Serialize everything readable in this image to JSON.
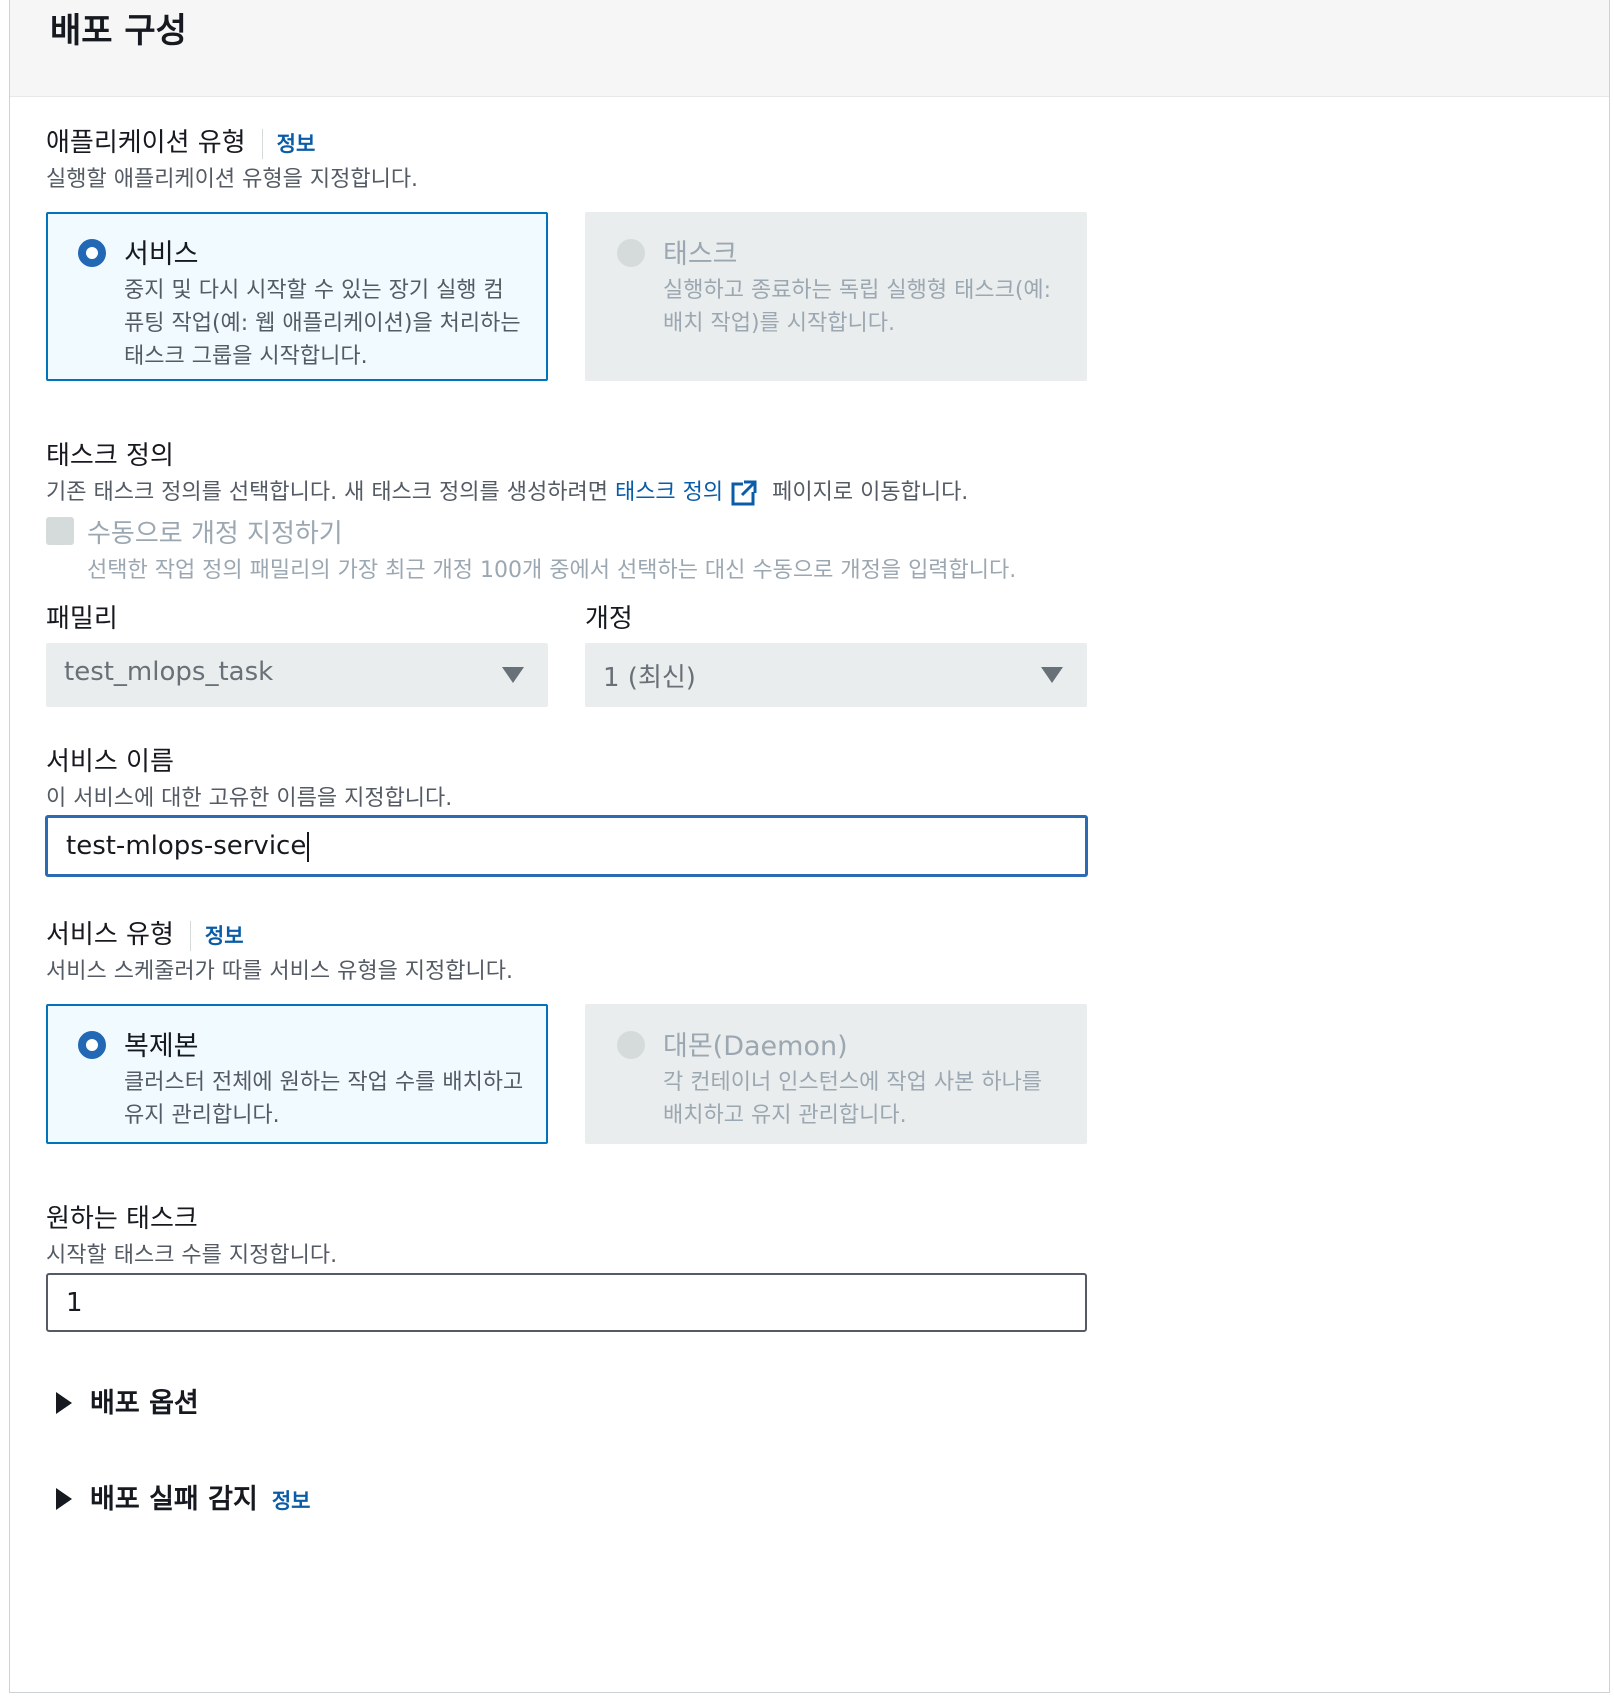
{
  "panel": {
    "title": "배포 구성"
  },
  "app_type": {
    "label": "애플리케이션 유형",
    "info": "정보",
    "description": "실행할 애플리케이션 유형을 지정합니다.",
    "options": [
      {
        "title": "서비스",
        "description": "중지 및 다시 시작할 수 있는 장기 실행 컴퓨팅 작업(예: 웹 애플리케이션)을 처리하는 태스크 그룹을 시작합니다.",
        "selected": true,
        "disabled": false
      },
      {
        "title": "태스크",
        "description": "실행하고 종료하는 독립 실행형 태스크(예: 배치 작업)를 시작합니다.",
        "selected": false,
        "disabled": true
      }
    ]
  },
  "task_definition": {
    "label": "태스크 정의",
    "description_before": "기존 태스크 정의를 선택합니다. 새 태스크 정의를 생성하려면 ",
    "link_text": "태스크 정의",
    "description_after": " 페이지로 이동합니다.",
    "manual_revision": {
      "label": "수동으로 개정 지정하기",
      "description": "선택한 작업 정의 패밀리의 가장 최근 개정 100개 중에서 선택하는 대신 수동으로 개정을 입력합니다.",
      "checked": false
    },
    "family": {
      "label": "패밀리",
      "value": "test_mlops_task"
    },
    "revision": {
      "label": "개정",
      "value": "1 (최신)"
    }
  },
  "service_name": {
    "label": "서비스 이름",
    "description": "이 서비스에 대한 고유한 이름을 지정합니다.",
    "value": "test-mlops-service"
  },
  "service_type": {
    "label": "서비스 유형",
    "info": "정보",
    "description": "서비스 스케줄러가 따를 서비스 유형을 지정합니다.",
    "options": [
      {
        "title": "복제본",
        "description": "클러스터 전체에 원하는 작업 수를 배치하고 유지 관리합니다.",
        "selected": true,
        "disabled": false
      },
      {
        "title": "대몬(Daemon)",
        "description": "각 컨테이너 인스턴스에 작업 사본 하나를 배치하고 유지 관리합니다.",
        "selected": false,
        "disabled": true
      }
    ]
  },
  "desired_tasks": {
    "label": "원하는 태스크",
    "description": "시작할 태스크 수를 지정합니다.",
    "value": "1"
  },
  "expanders": {
    "deployment_options": {
      "label": "배포 옵션"
    },
    "failure_detection": {
      "label": "배포 실패 감지",
      "info": "정보"
    }
  },
  "colors": {
    "accent": "#0073bb",
    "link": "#0a5ca8",
    "selected_tile_bg": "#f1faff",
    "disabled_bg": "#eaeded"
  },
  "icons": {
    "external_link": "external-link-icon",
    "expand": "caret-right-icon",
    "dropdown": "caret-down-icon"
  }
}
